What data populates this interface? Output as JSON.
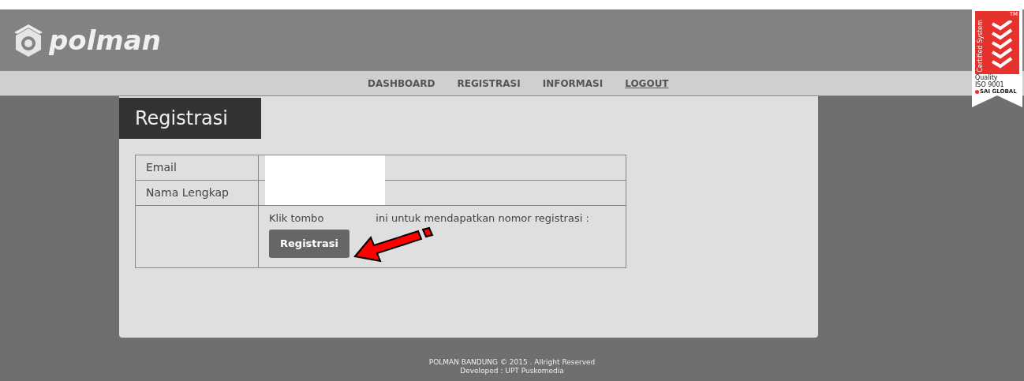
{
  "header": {
    "logo_text": "polman"
  },
  "badge": {
    "vertical_text": "Certified System",
    "tm": "TM",
    "line1": "Quality",
    "line2": "ISO 9001",
    "brand": "SAI GLOBAL"
  },
  "nav": [
    {
      "label": "DASHBOARD",
      "selected": false
    },
    {
      "label": "REGISTRASI",
      "selected": false
    },
    {
      "label": "INFORMASI",
      "selected": false
    },
    {
      "label": "LOGOUT",
      "selected": true
    }
  ],
  "page_title": "Registrasi",
  "form": {
    "rows": [
      {
        "label": "Email"
      },
      {
        "label": "Nama Lengkap"
      }
    ],
    "instruction_start": "Klik tombo",
    "instruction_end": "ini untuk mendapatkan nomor registrasi :",
    "button": "Registrasi"
  },
  "footer": {
    "line1": "POLMAN BANDUNG © 2015 . Allright Reserved",
    "line2": "Developed : UPT Puskomedia"
  }
}
